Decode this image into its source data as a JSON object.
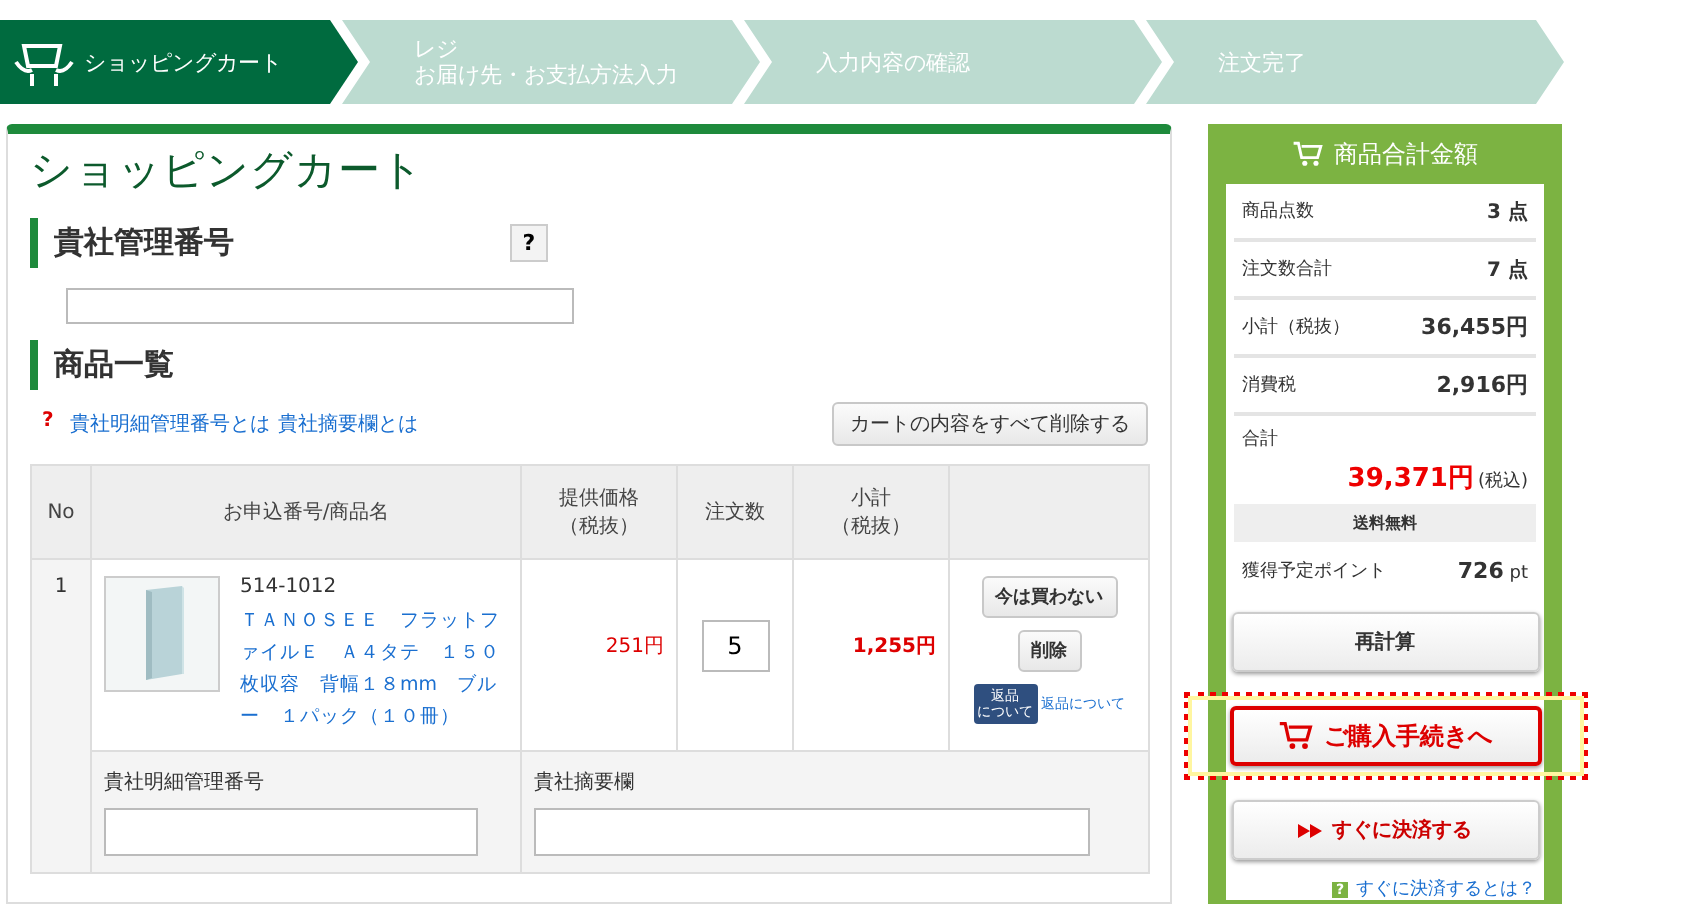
{
  "steps": [
    {
      "lines": [
        "ショッピングカート"
      ],
      "selected": true
    },
    {
      "lines": [
        "レジ",
        "お届け先・お支払方法入力"
      ],
      "selected": false
    },
    {
      "lines": [
        "入力内容の確認"
      ],
      "selected": false
    },
    {
      "lines": [
        "注文完了"
      ],
      "selected": false
    }
  ],
  "page_title": "ショッピングカート",
  "company_number": {
    "heading": "貴社管理番号",
    "help": "?"
  },
  "products_heading": "商品一覧",
  "help_links": {
    "mark": "?",
    "links": [
      "貴社明細管理番号とは",
      "貴社摘要欄とは"
    ]
  },
  "clear_button": "カートの内容をすべて削除する",
  "table": {
    "columns": [
      [
        "No"
      ],
      [
        "お申込番号/商品名"
      ],
      [
        "提供価格",
        "（税抜）"
      ],
      [
        "注文数"
      ],
      [
        "小計",
        "（税抜）"
      ]
    ],
    "rows": [
      {
        "no": "1",
        "code": "514-1012",
        "name": "ＴＡＮＯＳＥＥ　フラットファイルＥ　Ａ４タテ　１５０枚収容　背幅１８mm　ブルー　１パック（１０冊）",
        "kind": "picture",
        "price": "251円",
        "quantity": "5",
        "subtotal": "1,255円",
        "actions": [
          "今は買わない",
          "削除"
        ],
        "return_badge": [
          "返品",
          "について"
        ],
        "return_link": "返品について",
        "detail_label": "貴社明細管理番号",
        "memo_label": "貴社摘要欄"
      }
    ]
  },
  "summary": {
    "title": "商品合計金額",
    "rows": [
      {
        "label": "商品点数",
        "value": "3 点",
        "kind": "count"
      },
      {
        "label": "注文数合計",
        "value": "7 点",
        "kind": "count"
      },
      {
        "label": "小計（税抜）",
        "value": "36,455円",
        "kind": "amount"
      },
      {
        "label": "消費税",
        "value": "2,916円",
        "kind": "amount"
      }
    ],
    "total_label": "合計",
    "total": "39,371円",
    "total_note": "(税込)",
    "shipping": "送料無料",
    "points_label": "獲得予定ポイント",
    "points": "726",
    "points_unit": "pt",
    "recalc": "再計算",
    "checkout": "ご購入手続きへ",
    "quick_pay": "すぐに決済する",
    "help_mark": "?",
    "quick_help": "すぐに決済するとは？"
  }
}
